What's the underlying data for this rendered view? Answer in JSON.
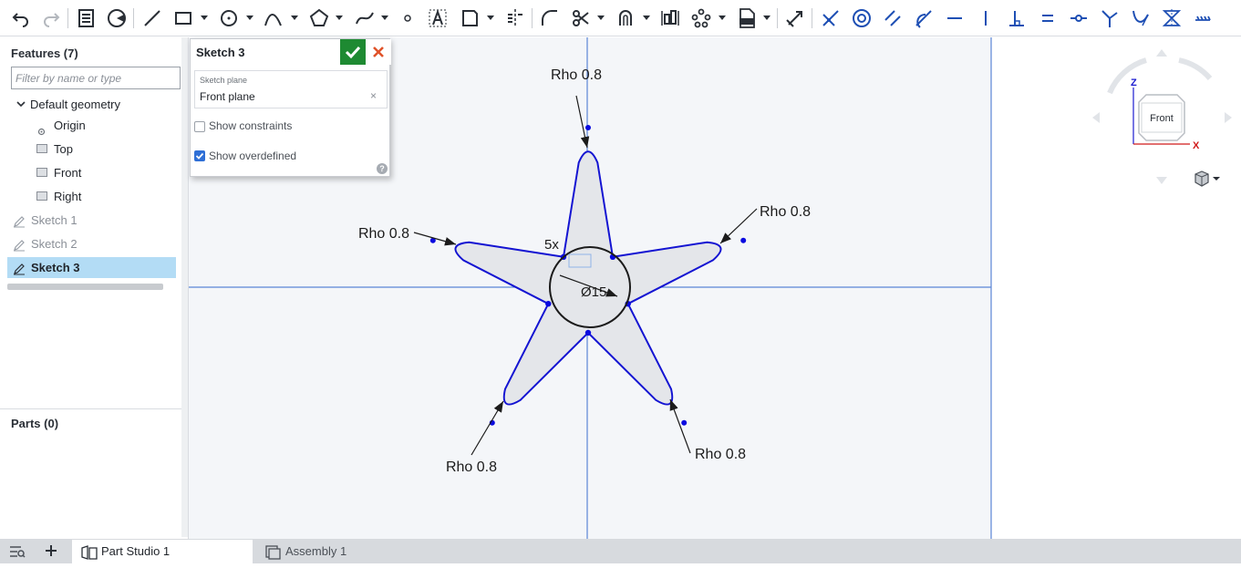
{
  "toolbar": {
    "icons": [
      "undo-icon",
      "redo-icon",
      "feature-list-icon",
      "sketch-mode-icon",
      "line-icon",
      "rectangle-icon",
      "circle-icon",
      "conic-icon",
      "polygon-icon",
      "spline-icon",
      "point-icon",
      "text-icon",
      "image-icon",
      "mirror-line-icon",
      "fillet-icon",
      "trim-icon",
      "offset-icon",
      "linear-pattern-icon",
      "circular-pattern-icon",
      "dxf-import-icon",
      "transform-icon",
      "coincident-icon",
      "concentric-icon",
      "parallel-icon",
      "tangent-icon",
      "horizontal-icon",
      "vertical-icon",
      "perpendicular-icon",
      "equal-icon",
      "midpoint-icon",
      "normal-icon",
      "curvature-icon",
      "symmetric-icon",
      "pierce-icon"
    ]
  },
  "features": {
    "title": "Features (7)",
    "filter_placeholder": "Filter by name or type",
    "items": [
      {
        "label": "Default geometry",
        "icon": "chevron-down-icon"
      },
      {
        "label": "Origin",
        "icon": "origin-icon"
      },
      {
        "label": "Top",
        "icon": "plane-icon"
      },
      {
        "label": "Front",
        "icon": "plane-icon"
      },
      {
        "label": "Right",
        "icon": "plane-icon"
      },
      {
        "label": "Sketch 1",
        "icon": "sketch-icon"
      },
      {
        "label": "Sketch 2",
        "icon": "sketch-icon"
      },
      {
        "label": "Sketch 3",
        "icon": "sketch-icon",
        "selected": true
      }
    ]
  },
  "parts": {
    "title": "Parts (0)"
  },
  "dialog": {
    "title": "Sketch 3",
    "plane_label": "Sketch plane",
    "plane_value": "Front plane",
    "clear_glyph": "×",
    "show_constraints": "Show constraints",
    "show_constraints_checked": false,
    "show_overdefined": "Show overdefined",
    "show_overdefined_checked": true,
    "help_glyph": "?"
  },
  "sketch": {
    "rho_label": "Rho 0.8",
    "pattern_count": "5x",
    "diameter": "Ø15",
    "colors": {
      "curve": "#1414d2",
      "fill": "#e4e6ea",
      "axis": "#5b86d6",
      "dimension": "#1b1b1b",
      "point": "#0a0ae0"
    }
  },
  "viewcube": {
    "face": "Front",
    "axis_z": "Z",
    "axis_x": "X",
    "z_color": "#1a1ad0",
    "x_color": "#d01a1a"
  },
  "tabs": [
    {
      "label": "Part Studio 1",
      "icon": "part-studio-icon",
      "active": true
    },
    {
      "label": "Assembly 1",
      "icon": "assembly-icon",
      "active": false
    }
  ]
}
